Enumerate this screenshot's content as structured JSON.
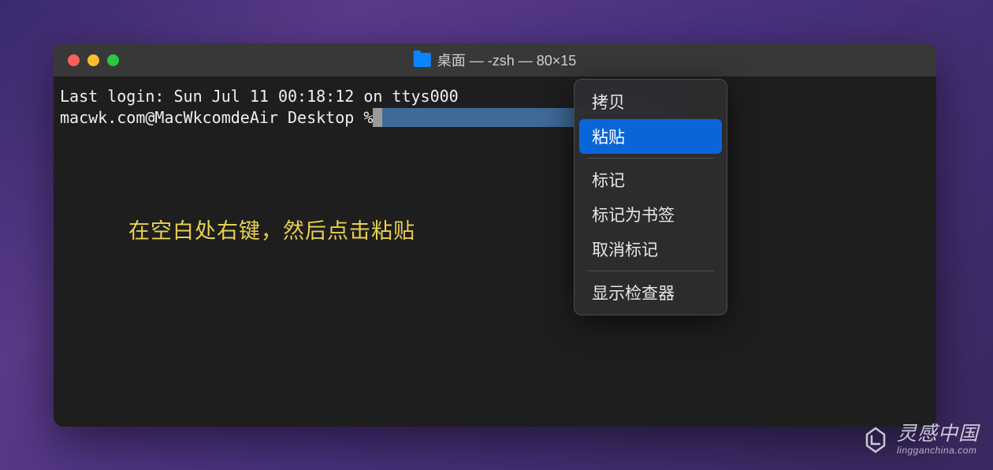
{
  "window": {
    "title": "桌面 — -zsh — 80×15"
  },
  "terminal": {
    "last_login": "Last login: Sun Jul 11 00:18:12 on ttys000",
    "prompt": "macwk.com@MacWkcomdeAir Desktop % "
  },
  "instruction": "在空白处右键，然后点击粘贴",
  "context_menu": {
    "items": [
      {
        "label": "拷贝",
        "selected": false
      },
      {
        "label": "粘贴",
        "selected": true
      }
    ],
    "group2": [
      {
        "label": "标记"
      },
      {
        "label": "标记为书签"
      },
      {
        "label": "取消标记"
      }
    ],
    "group3": [
      {
        "label": "显示检查器"
      }
    ]
  },
  "watermark": {
    "main": "灵感中国",
    "sub": "lingganchina.com"
  }
}
